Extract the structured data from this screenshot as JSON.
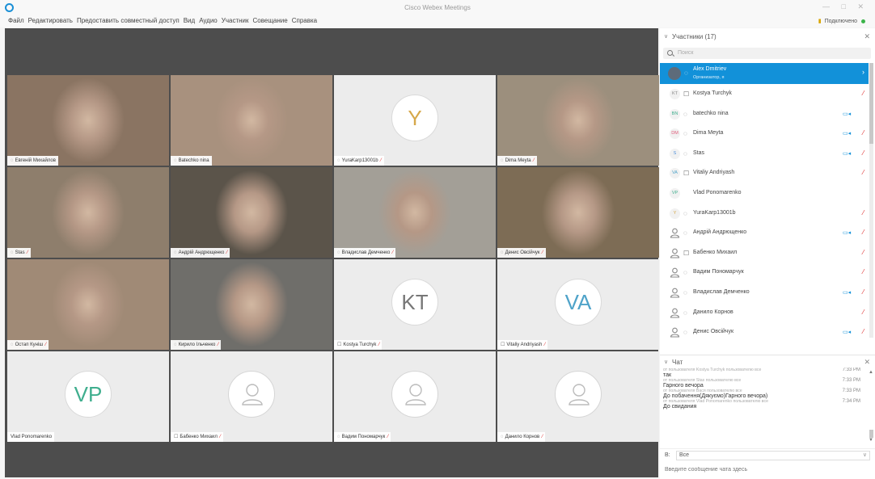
{
  "window": {
    "title": "Cisco Webex Meetings",
    "controls": "— □ ✕"
  },
  "menu": {
    "items": [
      "Файл",
      "Редактировать",
      "Предоставить совместный доступ",
      "Вид",
      "Аудио",
      "Участник",
      "Совещание",
      "Справка"
    ],
    "status": "Подключено"
  },
  "tiles": [
    {
      "type": "video",
      "name": "Евгеній Михайлов",
      "mic": false,
      "bg": "#8a7462"
    },
    {
      "type": "video",
      "name": "Batechko nina",
      "mic": false,
      "bg": "#a8917e"
    },
    {
      "type": "initial",
      "initials": "Y",
      "name": "YuraKarp13001b",
      "mic": true,
      "color": "#d6a84a"
    },
    {
      "type": "video",
      "name": "Dima Meyta",
      "mic": true,
      "bg": "#9c8f7d"
    },
    {
      "type": "video",
      "name": "Stas",
      "mic": true,
      "bg": "#8e7e6c"
    },
    {
      "type": "video",
      "name": "Андрій Андрющенко",
      "mic": true,
      "bg": "#5b544a"
    },
    {
      "type": "video",
      "name": "Владислав Демченко",
      "mic": true,
      "bg": "#a39f97"
    },
    {
      "type": "video",
      "name": "Денис Овсійчук",
      "mic": true,
      "bg": "#7d6c55"
    },
    {
      "type": "video",
      "name": "Остап Куніш",
      "mic": true,
      "bg": "#a08a76"
    },
    {
      "type": "video",
      "name": "Кирило Ільченко",
      "mic": true,
      "bg": "#6f6e6a"
    },
    {
      "type": "initial",
      "initials": "KT",
      "name": "Kostya Turchyk",
      "mic": true,
      "color": "#777777"
    },
    {
      "type": "initial",
      "initials": "VA",
      "name": "Vitaliy Andriyash",
      "mic": true,
      "color": "#4fa3c9"
    },
    {
      "type": "initial",
      "initials": "VP",
      "name": "Vlad Ponomarenko",
      "mic": false,
      "color": "#3fae8e"
    },
    {
      "type": "user",
      "name": "Бабенко Михаил",
      "mic": true
    },
    {
      "type": "user",
      "name": "Вадим Пономарчук",
      "mic": true
    },
    {
      "type": "user",
      "name": "Данило Корнов",
      "mic": true
    }
  ],
  "participants": {
    "title": "Участники (17)",
    "search_placeholder": "Поиск",
    "list": [
      {
        "name": "Alex Dmitriev",
        "role": "Организатор, я",
        "avatar": "photo",
        "selected": true
      },
      {
        "name": "Kostya Turchyk",
        "avatar": "KT",
        "av_color": "#888888",
        "device": "phone",
        "cam": false,
        "mic": true
      },
      {
        "name": "batechko nina",
        "avatar": "BN",
        "av_color": "#3fae8e",
        "device": "pc",
        "cam": true,
        "mic": false
      },
      {
        "name": "Dima Meyta",
        "avatar": "DM",
        "av_color": "#e05a7a",
        "device": "pc",
        "cam": true,
        "mic": true
      },
      {
        "name": "Stas",
        "avatar": "S",
        "av_color": "#4f8fd9",
        "device": "pc",
        "cam": true,
        "mic": true
      },
      {
        "name": "Vitaliy Andriyash",
        "avatar": "VA",
        "av_color": "#4fa3c9",
        "device": "phone",
        "cam": false,
        "mic": true
      },
      {
        "name": "Vlad Ponomarenko",
        "avatar": "VP",
        "av_color": "#3fae8e",
        "device": "",
        "cam": false,
        "mic": false
      },
      {
        "name": "YuraKarp13001b",
        "avatar": "Y",
        "av_color": "#d6a84a",
        "device": "pc",
        "cam": false,
        "mic": true
      },
      {
        "name": "Андрій Андрющенко",
        "avatar": "person",
        "device": "pc",
        "cam": true,
        "mic": true
      },
      {
        "name": "Бабенко Михаил",
        "avatar": "person",
        "device": "phone",
        "cam": false,
        "mic": true
      },
      {
        "name": "Вадим Пономарчук",
        "avatar": "person",
        "device": "pc",
        "cam": false,
        "mic": true
      },
      {
        "name": "Владислав Демченко",
        "avatar": "person",
        "device": "pc",
        "cam": true,
        "mic": true
      },
      {
        "name": "Данило Корнов",
        "avatar": "person",
        "device": "pc",
        "cam": false,
        "mic": true
      },
      {
        "name": "Денис Овсійчук",
        "avatar": "person",
        "device": "pc",
        "cam": true,
        "mic": true
      }
    ]
  },
  "chat": {
    "title": "Чат",
    "messages": [
      {
        "from": "от пользователя Kostya Turchyk пользователю все",
        "time": "7:33 PM",
        "text": "так"
      },
      {
        "from": "от пользователя Stas пользователю все",
        "time": "7:33 PM",
        "text": "Гарного вечора"
      },
      {
        "from": "от пользователя Вася пользователю все",
        "time": "7:33 PM",
        "text": "До побачення(Дякуємо)Гарного вечора)"
      },
      {
        "from": "от пользователя Vlad Ponomarenko пользователю все",
        "time": "7:34 PM",
        "text": "До свидания"
      }
    ],
    "to_label": "В:",
    "to_value": "Все",
    "input_placeholder": "Введите сообщение чата здесь"
  }
}
